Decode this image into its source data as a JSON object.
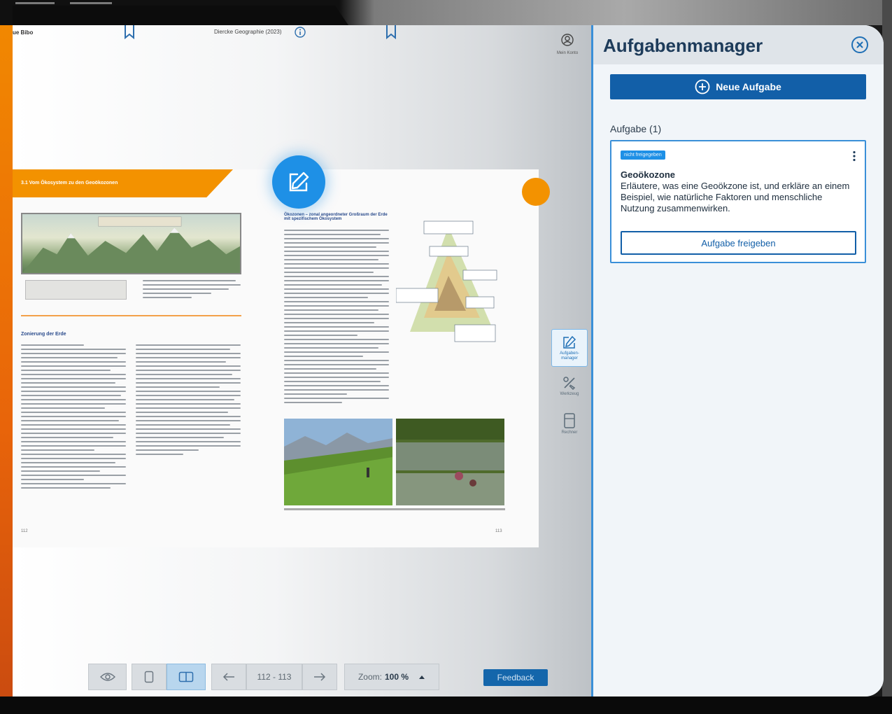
{
  "reader": {
    "library_label": "ue Bibo",
    "book_title": "Diercke Geographie (2023)",
    "account_label": "Mein Konto",
    "chapter_banner": "3.1 Vom Ökosystem zu den Geoökozonen",
    "section_heading_left": "Zonierung der Erde",
    "section_heading_right": "Ökozonen – zonal angeordneter Großraum der Erde mit spezifischem Ökosystem",
    "page_left": "112",
    "page_right": "113"
  },
  "toolstrip": {
    "items": [
      {
        "label": "Aufgaben-\nmanager",
        "icon": "pencil-square-icon",
        "active": true
      },
      {
        "label": "Werkzeug",
        "icon": "tools-icon",
        "active": false
      },
      {
        "label": "Rechner",
        "icon": "calculator-icon",
        "active": false
      }
    ]
  },
  "bottombar": {
    "page_range": "112 - 113",
    "zoom_label": "Zoom:",
    "zoom_value": "100 %",
    "feedback_label": "Feedback"
  },
  "panel": {
    "title": "Aufgabenmanager",
    "new_task_label": "Neue Aufgabe",
    "task_count_label": "Aufgabe (1)",
    "tasks": [
      {
        "badge": "nicht freigegeben",
        "title": "Geoökozone",
        "description": "Erläutere, was eine Geoökzone ist, und erkläre an einem Beispiel, wie natürliche Faktoren und menschliche Nutzung zusammenwirken.",
        "release_label": "Aufgabe freigeben"
      }
    ]
  },
  "colors": {
    "accent_blue": "#125fa8",
    "fab_blue": "#1e90e6",
    "book_orange": "#f39200"
  }
}
